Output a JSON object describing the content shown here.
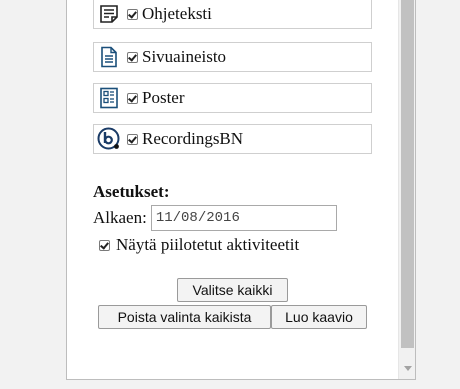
{
  "modules": [
    {
      "label": "Ohjeteksti",
      "icon": "document-lines-icon",
      "checked": true
    },
    {
      "label": "Sivuaineisto",
      "icon": "page-icon",
      "checked": true
    },
    {
      "label": "Poster",
      "icon": "poster-icon",
      "checked": true
    },
    {
      "label": "RecordingsBN",
      "icon": "bigbluebutton-icon",
      "checked": true
    }
  ],
  "settings": {
    "title": "Asetukset:",
    "start_label": "Alkaen:",
    "start_value": "11/08/2016",
    "show_hidden_label": "Näytä piilotetut aktiviteetit",
    "show_hidden_checked": true
  },
  "buttons": {
    "select_all": "Valitse kaikki",
    "deselect_all": "Poista valinta kaikista",
    "create_chart": "Luo kaavio"
  }
}
